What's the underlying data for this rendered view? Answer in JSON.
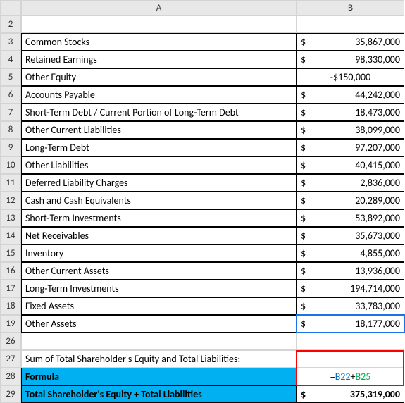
{
  "columns": {
    "A": "A",
    "B": "B"
  },
  "rownums": {
    "r2": "2",
    "r3": "3",
    "r4": "4",
    "r5": "5",
    "r6": "6",
    "r7": "7",
    "r8": "8",
    "r9": "9",
    "r10": "10",
    "r11": "11",
    "r12": "12",
    "r13": "13",
    "r14": "14",
    "r15": "15",
    "r16": "16",
    "r17": "17",
    "r18": "18",
    "r19": "19",
    "r26": "26",
    "r27": "27",
    "r28": "28",
    "r29": "29"
  },
  "currency_symbol": "$",
  "data_rows": {
    "r3": {
      "label": "Common Stocks",
      "value": "35,867,000",
      "symbol": true
    },
    "r4": {
      "label": "Retained Earnings",
      "value": "98,330,000",
      "symbol": true
    },
    "r5": {
      "label": "Other Equity",
      "value_neg": "-$150,000"
    },
    "r6": {
      "label": "Accounts Payable",
      "value": "44,242,000",
      "symbol": true
    },
    "r7": {
      "label": "Short-Term Debt / Current Portion of Long-Term Debt",
      "value": "18,473,000",
      "symbol": true
    },
    "r8": {
      "label": "Other Current Liabilities",
      "value": "38,099,000",
      "symbol": true
    },
    "r9": {
      "label": "Long-Term Debt",
      "value": "97,207,000",
      "symbol": true
    },
    "r10": {
      "label": "Other Liabilities",
      "value": "40,415,000",
      "symbol": true
    },
    "r11": {
      "label": "Deferred Liability Charges",
      "value": "2,836,000",
      "symbol": true
    },
    "r12": {
      "label": "Cash and Cash Equivalents",
      "value": "20,289,000",
      "symbol": true
    },
    "r13": {
      "label": "Short-Term Investments",
      "value": "53,892,000",
      "symbol": true
    },
    "r14": {
      "label": "Net Receivables",
      "value": "35,673,000",
      "symbol": true
    },
    "r15": {
      "label": "Inventory",
      "value": "4,855,000",
      "symbol": true
    },
    "r16": {
      "label": "Other Current Assets",
      "value": "13,936,000",
      "symbol": true
    },
    "r17": {
      "label": "Long-Term Investments",
      "value": "194,714,000",
      "symbol": true
    },
    "r18": {
      "label": "Fixed Assets",
      "value": "33,783,000",
      "symbol": true
    },
    "r19": {
      "label": "Other Assets",
      "value": "18,177,000",
      "symbol": true
    }
  },
  "section": {
    "r27_label": "Sum of Total Shareholder's Equity and Total Liabilities:",
    "r28_label": "Formula",
    "r28_formula": {
      "eq": "=",
      "ref1": "B22",
      "plus": "+",
      "ref2": "B25"
    },
    "r29_label": "Total Shareholder's Equity + Total Liabilities",
    "r29_value": "375,319,000"
  },
  "chart_data": {
    "type": "table",
    "title": "Balance Sheet Items and Shareholder Equity Summation",
    "rows": [
      {
        "row": 3,
        "item": "Common Stocks",
        "value": 35867000
      },
      {
        "row": 4,
        "item": "Retained Earnings",
        "value": 98330000
      },
      {
        "row": 5,
        "item": "Other Equity",
        "value": -150000
      },
      {
        "row": 6,
        "item": "Accounts Payable",
        "value": 44242000
      },
      {
        "row": 7,
        "item": "Short-Term Debt / Current Portion of Long-Term Debt",
        "value": 18473000
      },
      {
        "row": 8,
        "item": "Other Current Liabilities",
        "value": 38099000
      },
      {
        "row": 9,
        "item": "Long-Term Debt",
        "value": 97207000
      },
      {
        "row": 10,
        "item": "Other Liabilities",
        "value": 40415000
      },
      {
        "row": 11,
        "item": "Deferred Liability Charges",
        "value": 2836000
      },
      {
        "row": 12,
        "item": "Cash and Cash Equivalents",
        "value": 20289000
      },
      {
        "row": 13,
        "item": "Short-Term Investments",
        "value": 53892000
      },
      {
        "row": 14,
        "item": "Net Receivables",
        "value": 35673000
      },
      {
        "row": 15,
        "item": "Inventory",
        "value": 4855000
      },
      {
        "row": 16,
        "item": "Other Current Assets",
        "value": 13936000
      },
      {
        "row": 17,
        "item": "Long-Term Investments",
        "value": 194714000
      },
      {
        "row": 18,
        "item": "Fixed Assets",
        "value": 33783000
      },
      {
        "row": 19,
        "item": "Other Assets",
        "value": 18177000
      }
    ],
    "summary": {
      "row": 27,
      "label": "Sum of Total Shareholder's Equity and Total Liabilities:",
      "formula_row": 28,
      "formula": "=B22+B25",
      "result_row": 29,
      "result_label": "Total Shareholder's Equity + Total Liabilities",
      "result_value": 375319000
    }
  }
}
